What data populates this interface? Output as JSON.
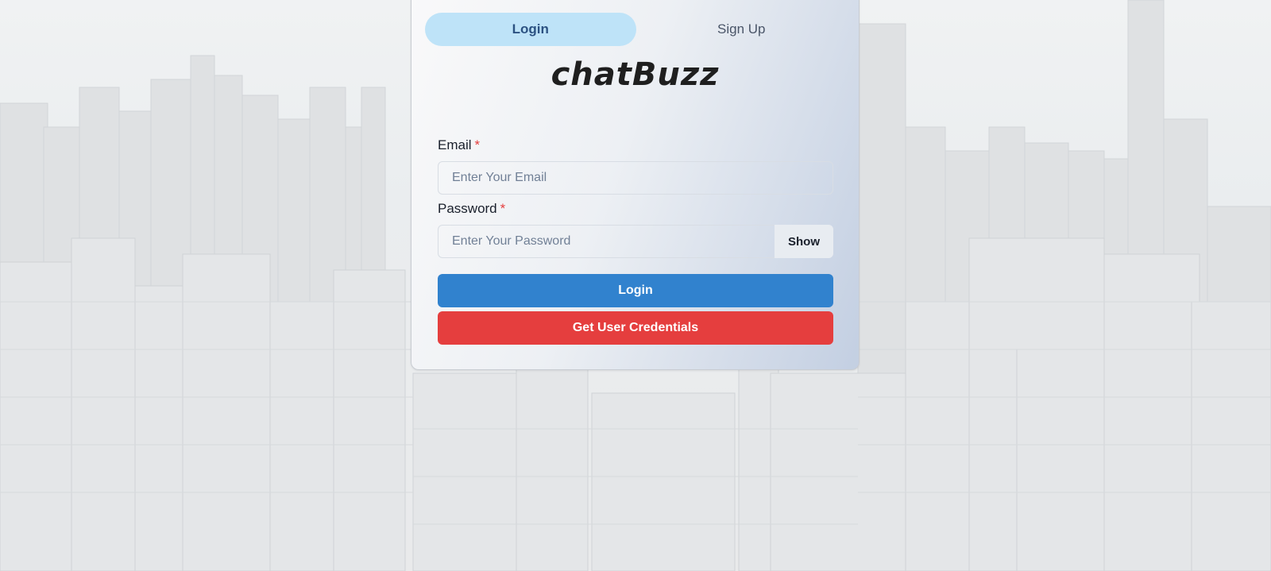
{
  "tabs": [
    {
      "label": "Login",
      "active": true
    },
    {
      "label": "Sign Up",
      "active": false
    }
  ],
  "logo": {
    "text": "chatBuzz"
  },
  "email": {
    "label": "Email",
    "required_mark": "*",
    "placeholder": "Enter Your Email",
    "value": ""
  },
  "password": {
    "label": "Password",
    "required_mark": "*",
    "placeholder": "Enter Your Password",
    "value": "",
    "show_label": "Show"
  },
  "buttons": {
    "login_label": "Login",
    "credentials_label": "Get User Credentials"
  },
  "colors": {
    "primary": "#3182ce",
    "danger": "#e53e3e",
    "active_tab": "#bee3f8",
    "required": "#e53e3e"
  }
}
